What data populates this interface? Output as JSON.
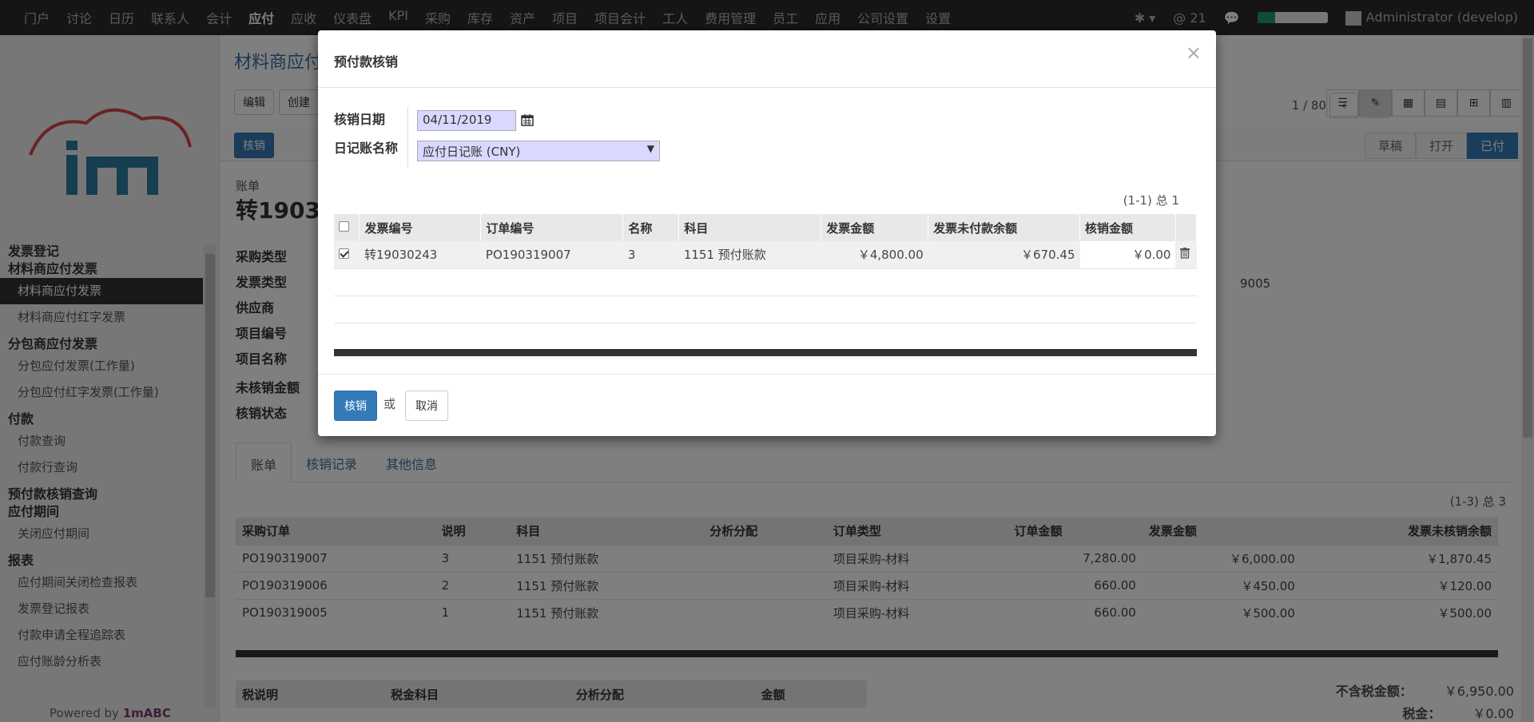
{
  "topbar": {
    "menus": [
      "门户",
      "讨论",
      "日历",
      "联系人",
      "会计",
      "应付",
      "应收",
      "仪表盘",
      "KPI",
      "采购",
      "库存",
      "资产",
      "项目",
      "项目会计",
      "工人",
      "费用管理",
      "员工",
      "应用",
      "公司设置",
      "设置"
    ],
    "active_menu": "应付",
    "mentions": "@ 21",
    "progress": 0.25,
    "user": "Administrator (develop)"
  },
  "sidebar": {
    "sections": [
      {
        "title": "发票登记",
        "items": []
      },
      {
        "title": "材料商应付发票",
        "items": [
          "材料商应付发票",
          "材料商应付红字发票"
        ]
      },
      {
        "title": "分包商应付发票",
        "items": [
          "分包应付发票(工作量)",
          "分包应付红字发票(工作量)"
        ]
      },
      {
        "title": "付款",
        "items": [
          "付款查询",
          "付款行查询"
        ]
      },
      {
        "title": "预付款核销查询",
        "items": []
      },
      {
        "title": "应付期间",
        "items": [
          "关闭应付期间"
        ]
      },
      {
        "title": "报表",
        "items": [
          "应付期间关闭检查报表",
          "发票登记报表",
          "付款申请全程追踪表",
          "应付账龄分析表"
        ]
      }
    ],
    "active_item": "材料商应付发票",
    "powered_prefix": "Powered by ",
    "powered_brand": "1mABC"
  },
  "main": {
    "breadcrumb": "材料商应付",
    "edit_label": "编辑",
    "create_label": "创建",
    "pager": "1 / 80",
    "writeoff_label": "核销",
    "stages": [
      "草稿",
      "打开",
      "已付"
    ],
    "current_stage": "已付",
    "sheet_label": "账单",
    "sheet_title": "转1903",
    "fields": [
      "采购类型",
      "发票类型",
      "供应商",
      "项目编号",
      "项目名称",
      "未核销金额",
      "核销状态"
    ],
    "partial_value": "9005",
    "tabs": [
      "账单",
      "核销记录",
      "其他信息"
    ],
    "active_tab": "账单",
    "lines_count": "(1-3) 总 3",
    "lines_columns": [
      "采购订单",
      "说明",
      "科目",
      "分析分配",
      "订单类型",
      "订单金额",
      "发票金额",
      "发票未核销余额"
    ],
    "lines": [
      [
        "PO190319007",
        "3",
        "1151 预付账款",
        "",
        "项目采购-材料",
        "7,280.00",
        "￥6,000.00",
        "￥1,870.45"
      ],
      [
        "PO190319006",
        "2",
        "1151 预付账款",
        "",
        "项目采购-材料",
        "660.00",
        "￥450.00",
        "￥120.00"
      ],
      [
        "PO190319005",
        "1",
        "1151 预付账款",
        "",
        "项目采购-材料",
        "660.00",
        "￥500.00",
        "￥500.00"
      ]
    ],
    "tax_columns": [
      "税说明",
      "税金科目",
      "分析分配",
      "金额"
    ],
    "totals": [
      {
        "label": "不含税金额：",
        "value": "￥6,950.00"
      },
      {
        "label": "税金：",
        "value": "￥0.00"
      }
    ]
  },
  "modal": {
    "title": "预付款核销",
    "close": "×",
    "date_label": "核销日期",
    "date_value": "04/11/2019",
    "journal_label": "日记账名称",
    "journal_value": "应付日记账 (CNY)",
    "count": "(1-1) 总 1",
    "columns": [
      "发票编号",
      "订单编号",
      "名称",
      "科目",
      "发票金额",
      "发票未付款余额",
      "核销金额"
    ],
    "rows": [
      [
        "转19030243",
        "PO190319007",
        "3",
        "1151 预付账款",
        "￥4,800.00",
        "￥670.45",
        "￥0.00"
      ]
    ],
    "ok_label": "核销",
    "or_label": "或",
    "cancel_label": "取消"
  }
}
